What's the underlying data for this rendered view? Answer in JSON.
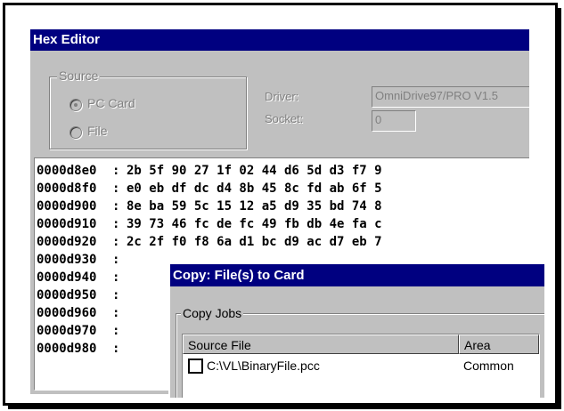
{
  "hex_editor": {
    "title": "Hex Editor",
    "source_group": {
      "legend": "Source",
      "options": [
        {
          "label": "PC Card",
          "selected": true
        },
        {
          "label": "File",
          "selected": false
        }
      ]
    },
    "driver_label": "Driver:",
    "driver_value": "OmniDrive97/PRO  V1.5",
    "socket_label": "Socket:",
    "socket_value": "0",
    "rows": [
      {
        "address": "0000d8e0",
        "sep": ":",
        "bytes": "2b 5f 90 27 1f 02 44 d6 5d d3 f7 9"
      },
      {
        "address": "0000d8f0",
        "sep": ":",
        "bytes": "e0 eb df dc d4 8b 45 8c fd ab 6f 5"
      },
      {
        "address": "0000d900",
        "sep": ":",
        "bytes": "8e ba 59 5c 15 12 a5 d9 35 bd 74 8"
      },
      {
        "address": "0000d910",
        "sep": ":",
        "bytes": "39 73 46 fc de fc 49 fb db 4e fa c"
      },
      {
        "address": "0000d920",
        "sep": ":",
        "bytes": "2c 2f f0 f8 6a d1 bc d9 ac d7 eb 7"
      },
      {
        "address": "0000d930",
        "sep": ":",
        "bytes": ""
      },
      {
        "address": "0000d940",
        "sep": ":",
        "bytes": ""
      },
      {
        "address": "0000d950",
        "sep": ":",
        "bytes": ""
      },
      {
        "address": "0000d960",
        "sep": ":",
        "bytes": ""
      },
      {
        "address": "0000d970",
        "sep": ":",
        "bytes": ""
      },
      {
        "address": "0000d980",
        "sep": ":",
        "bytes": ""
      }
    ]
  },
  "copy_dialog": {
    "title": "Copy: File(s) to Card",
    "group_legend": "Copy Jobs",
    "columns": [
      "Source File",
      "Area"
    ],
    "jobs": [
      {
        "source_file": "C:\\VL\\BinaryFile.pcc",
        "area": "Common",
        "checked": false
      }
    ]
  }
}
